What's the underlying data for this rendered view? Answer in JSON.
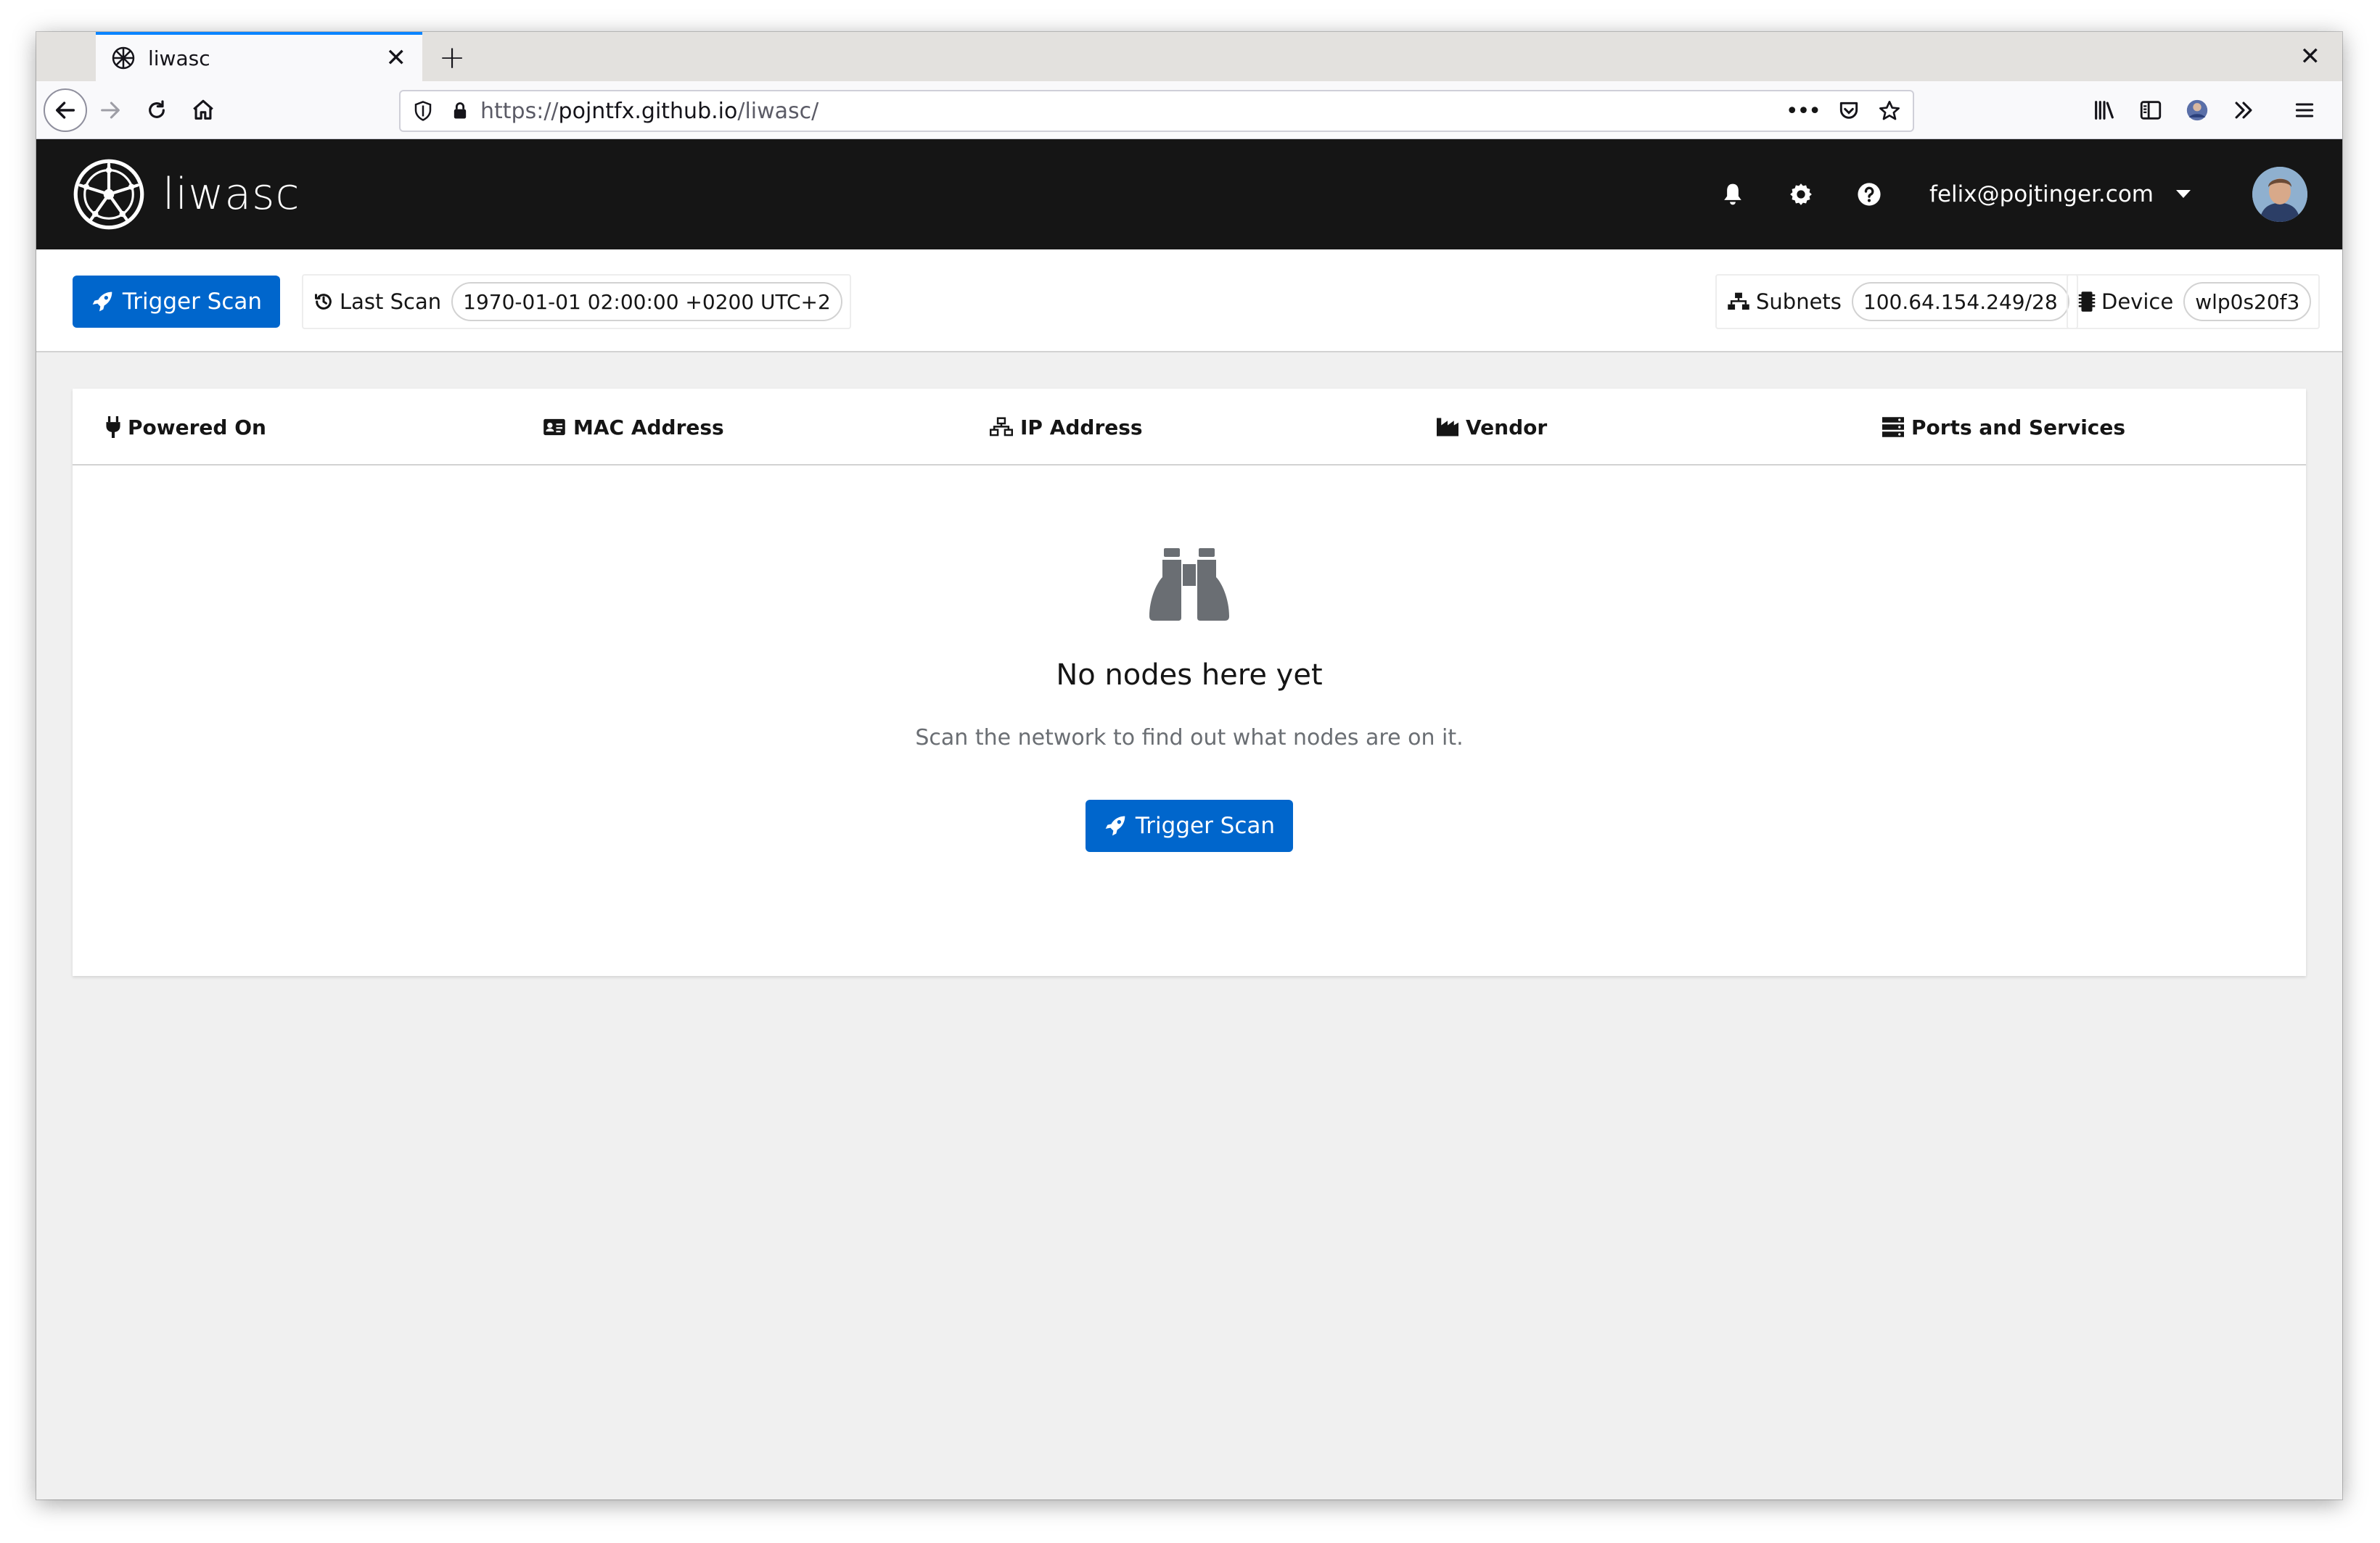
{
  "browser": {
    "tab_title": "liwasc",
    "new_tab_glyph": "+",
    "tab_close_glyph": "✕",
    "window_close_glyph": "✕",
    "url_prefix": "https://",
    "url_host": "pojntfx.github.io",
    "url_path": "/liwasc/",
    "page_actions_glyph": "•••"
  },
  "header": {
    "brand": "liwasc",
    "user_email": "felix@pojtinger.com",
    "icons": [
      "bell-icon",
      "gear-icon",
      "help-icon"
    ]
  },
  "toolbar": {
    "trigger_label": "Trigger Scan",
    "last_scan_label": "Last Scan",
    "last_scan_value": "1970-01-01 02:00:00 +0200 UTC+2",
    "subnets_label": "Subnets",
    "subnets_value": "100.64.154.249/28",
    "device_label": "Device",
    "device_value": "wlp0s20f3"
  },
  "table": {
    "columns": [
      {
        "label": "Powered On",
        "icon": "plug-icon"
      },
      {
        "label": "MAC Address",
        "icon": "id-card-icon"
      },
      {
        "label": "IP Address",
        "icon": "network-icon"
      },
      {
        "label": "Vendor",
        "icon": "industry-icon"
      },
      {
        "label": "Ports and Services",
        "icon": "server-icon"
      }
    ]
  },
  "empty_state": {
    "icon": "binoculars-icon",
    "title": "No nodes here yet",
    "body": "Scan the network to find out what nodes are on it.",
    "button_label": "Trigger Scan"
  },
  "colors": {
    "primary": "#0066cc",
    "header_bg": "#151515",
    "page_bg": "#f0f0f0",
    "tab_accent": "#0a84ff"
  }
}
